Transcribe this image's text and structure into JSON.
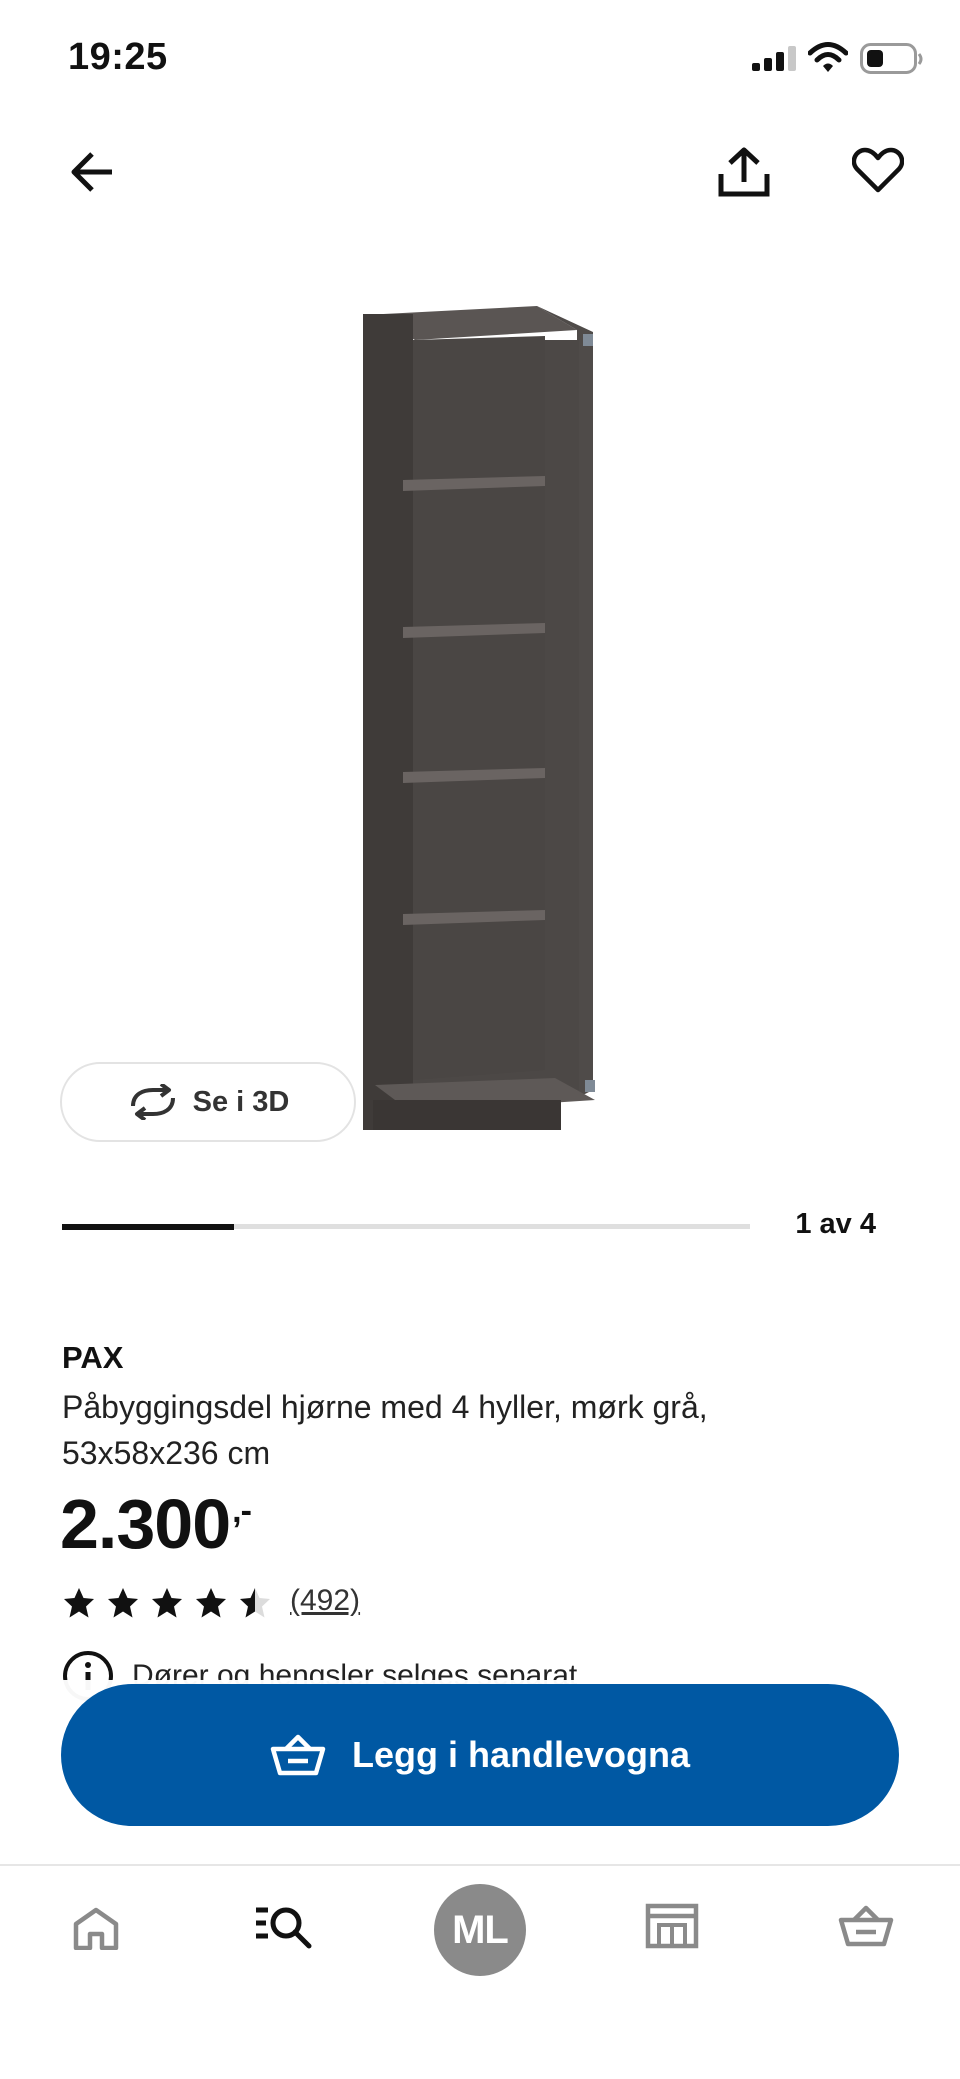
{
  "status_bar": {
    "time": "19:25"
  },
  "toolbar": {
    "back_icon": "arrow-left-icon",
    "share_icon": "share-icon",
    "favorite_icon": "heart-icon"
  },
  "gallery": {
    "view_3d_label": "Se i 3D",
    "view_3d_icon": "rotate-arrows-icon",
    "counter": "1 av 4",
    "progress": 0.25
  },
  "product": {
    "brand": "PAX",
    "description": "Påbyggingsdel hjørne med 4 hyller, mørk grå, 53x58x236 cm",
    "price": "2.300",
    "price_suffix": ",-",
    "rating": 4.5,
    "rating_max": 5,
    "reviews": "(492)",
    "info_text": "Dører og hengsler selges separat"
  },
  "cart_button": {
    "label": "Legg i handlevogna",
    "icon": "basket-icon"
  },
  "tab_bar": {
    "items": [
      {
        "name": "home",
        "icon": "home-icon"
      },
      {
        "name": "search",
        "icon": "search-list-icon"
      },
      {
        "name": "profile",
        "initials": "ML"
      },
      {
        "name": "store",
        "icon": "store-icon"
      },
      {
        "name": "cart",
        "icon": "basket-icon"
      }
    ]
  },
  "colors": {
    "primary": "#0058a3",
    "text": "#111111",
    "avatar": "#8a8a8a",
    "product": "#4b4644"
  }
}
